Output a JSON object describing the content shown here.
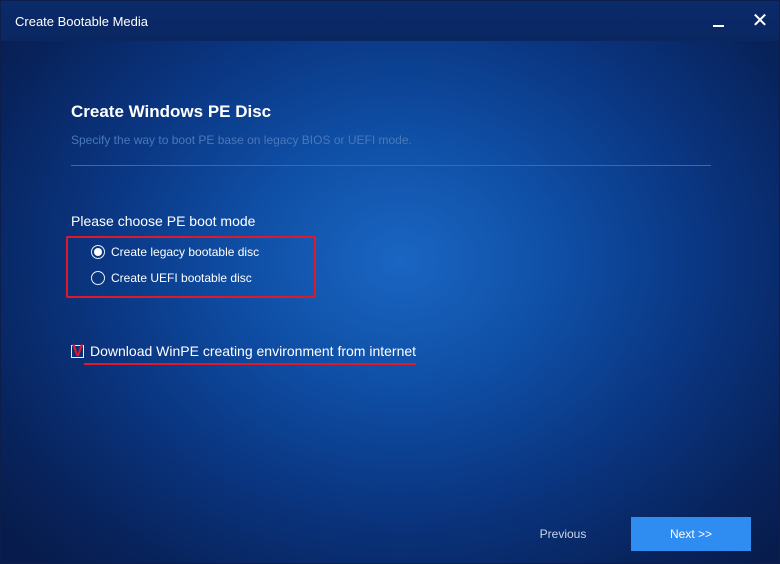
{
  "window": {
    "title": "Create Bootable Media",
    "minimize_icon": "minimize-icon",
    "close_icon": "close-icon",
    "close_glyph": "✕"
  },
  "content": {
    "heading": "Create Windows PE Disc",
    "subheading": "Specify the way to boot PE base on legacy BIOS or UEFI mode.",
    "section_label": "Please choose PE boot mode",
    "options": [
      {
        "label": "Create legacy bootable disc",
        "selected": true
      },
      {
        "label": "Create UEFI bootable disc",
        "selected": false
      }
    ],
    "download_checkbox": {
      "label": "Download WinPE creating environment from internet",
      "checked": true
    }
  },
  "footer": {
    "previous_label": "Previous",
    "next_label": "Next >>"
  },
  "colors": {
    "accent": "#2f8cf0",
    "annotation_red": "#e0192a",
    "titlebar": "#0a2761"
  }
}
